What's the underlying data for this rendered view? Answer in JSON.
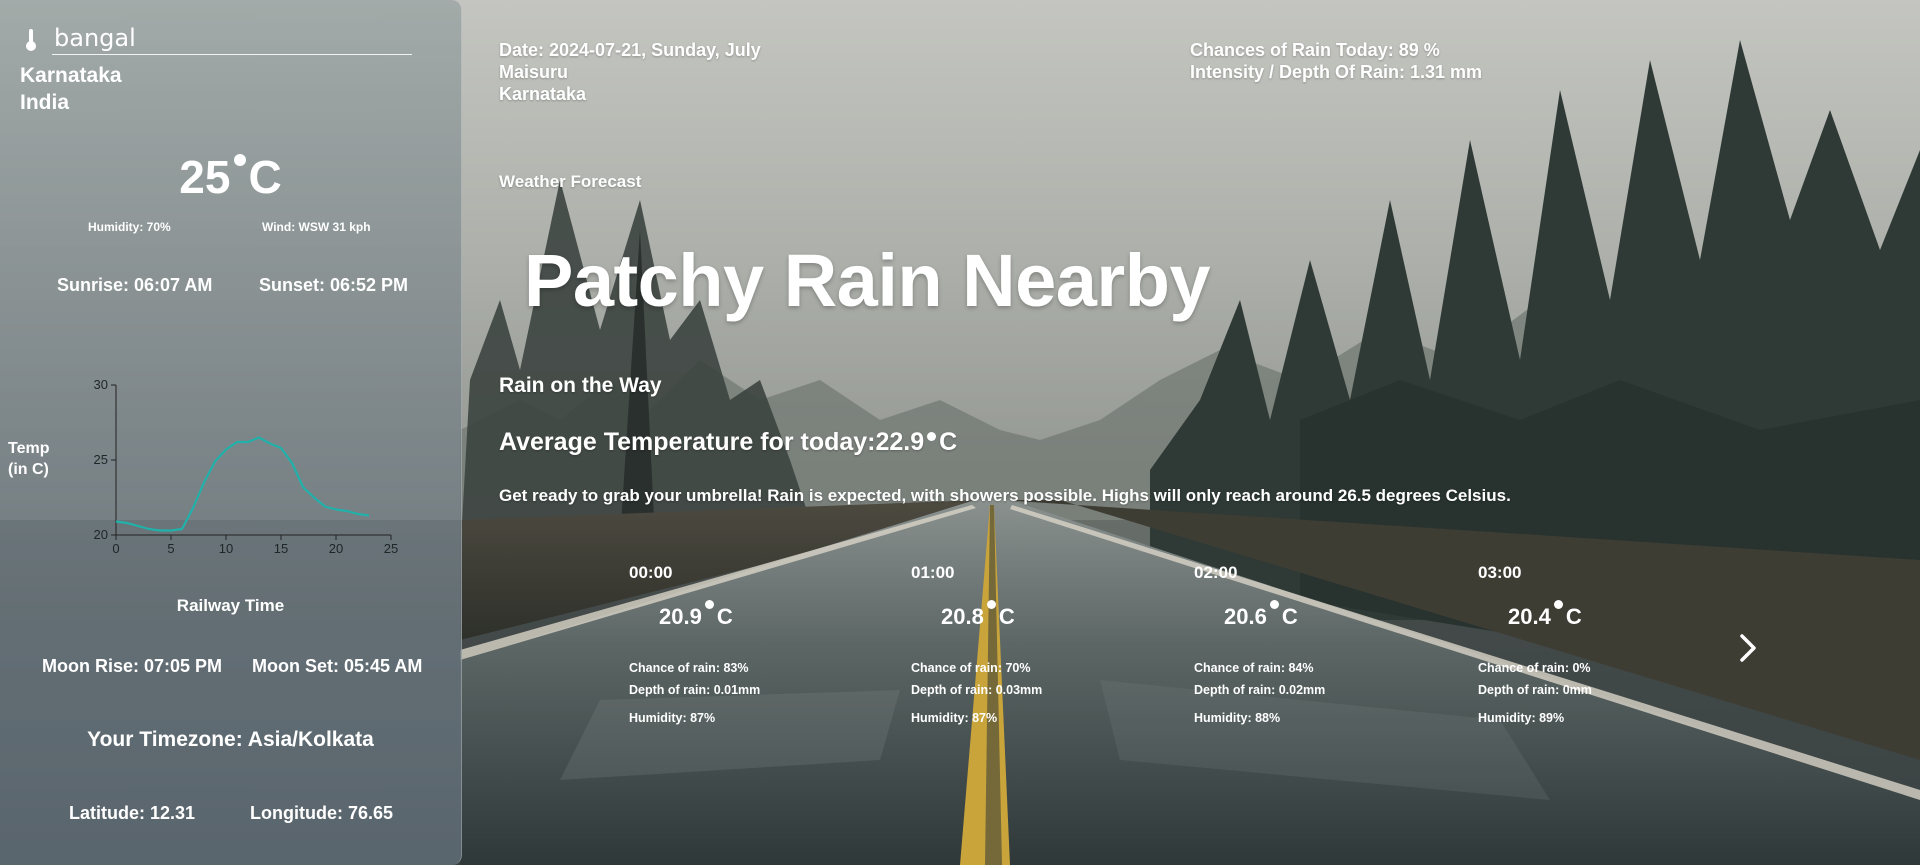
{
  "search": {
    "value": "bangal",
    "icon": "thermometer-icon"
  },
  "location": {
    "region": "Karnataka",
    "country": "India",
    "city": "Maisuru"
  },
  "current": {
    "temp": "25",
    "unit": "C",
    "humidity": "Humidity: 70%",
    "wind": "Wind: WSW 31 kph",
    "sunrise": "Sunrise: 06:07 AM",
    "sunset": "Sunset: 06:52 PM"
  },
  "temp_chart": {
    "ylabel_line1": "Temp",
    "ylabel_line2": "(in C)",
    "xlabel": "Railway Time",
    "x_ticks": [
      "0",
      "5",
      "10",
      "15",
      "20",
      "25"
    ],
    "y_ticks": [
      "20",
      "25",
      "30"
    ],
    "line_color": "#20b2aa"
  },
  "chart_data": {
    "type": "line",
    "x": [
      0,
      1,
      2,
      3,
      4,
      5,
      6,
      7,
      8,
      9,
      10,
      11,
      12,
      13,
      14,
      15,
      16,
      17,
      18,
      19,
      20,
      21,
      22,
      23
    ],
    "values": [
      20.9,
      20.8,
      20.6,
      20.4,
      20.3,
      20.3,
      20.4,
      21.8,
      23.5,
      24.9,
      25.7,
      26.2,
      26.2,
      26.5,
      26.1,
      25.8,
      24.8,
      23.2,
      22.5,
      21.9,
      21.7,
      21.6,
      21.4,
      21.3
    ],
    "xlabel": "Railway Time",
    "ylabel": "Temp (in C)",
    "xlim": [
      0,
      25
    ],
    "ylim": [
      20,
      30
    ]
  },
  "astro": {
    "moonrise": "Moon Rise: 07:05 PM",
    "moonset": "Moon Set: 05:45 AM",
    "timezone": "Your Timezone: Asia/Kolkata",
    "latitude": "Latitude: 12.31",
    "longitude": "Longitude: 76.65"
  },
  "main": {
    "date": "Date: 2024-07-21, Sunday, July",
    "rain_chance_today": "Chances of Rain Today: 89 %",
    "rain_intensity": "Intensity / Depth Of Rain: 1.31 mm",
    "section_label": "Weather Forecast",
    "condition": "Patchy Rain Nearby",
    "tagline": "Rain on the Way",
    "avg_temp_label": "Average Temperature for today:22.9",
    "avg_temp_unit": "C",
    "summary": "Get ready to grab your umbrella! Rain is expected, with showers possible. Highs will only reach around 26.5 degrees Celsius."
  },
  "hourly": [
    {
      "time": "00:00",
      "temp": "20.9",
      "unit": "C",
      "chance": "Chance of rain: 83%",
      "depth": "Depth of rain: 0.01mm",
      "humidity": "Humidity: 87%"
    },
    {
      "time": "01:00",
      "temp": "20.8",
      "unit": "C",
      "chance": "Chance of rain: 70%",
      "depth": "Depth of rain: 0.03mm",
      "humidity": "Humidity: 87%"
    },
    {
      "time": "02:00",
      "temp": "20.6",
      "unit": "C",
      "chance": "Chance of rain: 84%",
      "depth": "Depth of rain: 0.02mm",
      "humidity": "Humidity: 88%"
    },
    {
      "time": "03:00",
      "temp": "20.4",
      "unit": "C",
      "chance": "Chance of rain: 0%",
      "depth": "Depth of rain: 0mm",
      "humidity": "Humidity: 89%"
    }
  ],
  "nav": {
    "next_icon": "chevron-right-icon"
  }
}
